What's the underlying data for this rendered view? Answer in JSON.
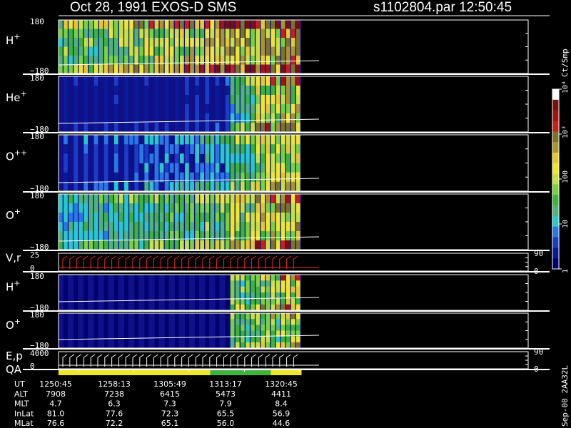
{
  "header": {
    "title_left": "Oct 28, 1991    EXOS-D SMS",
    "title_right": "s1102804.par  12:50:45"
  },
  "colorbar": {
    "label": "Ct/Smp",
    "ticks": [
      {
        "value": 1,
        "label": "1"
      },
      {
        "value": 10,
        "label": "10"
      },
      {
        "value": 100,
        "label": "100"
      },
      {
        "value": 1000,
        "label": "10³"
      },
      {
        "value": 10000,
        "label": "10⁴"
      }
    ],
    "colors": [
      "#000070",
      "#0a1a96",
      "#1a3cc8",
      "#2878e6",
      "#28c8c8",
      "#50b478",
      "#3cb43c",
      "#78d23c",
      "#c8e13c",
      "#f0e628",
      "#e6c828",
      "#aa9628",
      "#7d7328",
      "#c81e1e",
      "#a01414",
      "#781010",
      "#ffffff"
    ]
  },
  "footer": {
    "version": "Sep-00  2AA32L",
    "table_rows": [
      {
        "label": "UT",
        "values": [
          "1250:45",
          "1258:13",
          "1305:49",
          "1313:17",
          "1320:45"
        ]
      },
      {
        "label": "ALT",
        "values": [
          "7908",
          "7238",
          "6415",
          "5473",
          "4411"
        ]
      },
      {
        "label": "MLT",
        "values": [
          "4.7",
          "6.3",
          "7.3",
          "7.9",
          "8.4"
        ]
      },
      {
        "label": "InLat",
        "values": [
          "81.0",
          "77.6",
          "72.3",
          "65.5",
          "56.9"
        ]
      },
      {
        "label": "MLat",
        "values": [
          "76.6",
          "72.2",
          "65.1",
          "56.0",
          "44.6"
        ]
      }
    ]
  },
  "chart_data": [
    {
      "type": "heatmap",
      "label": "H",
      "sup": "+",
      "ylim": [
        -180,
        180
      ],
      "yticks": [
        "180",
        "−180"
      ],
      "intensity": [
        0.6,
        0.65,
        0.7,
        0.75,
        0.8,
        0.85,
        0.9,
        0.95,
        1.0,
        1.0
      ]
    },
    {
      "type": "heatmap",
      "label": "He",
      "sup": "+",
      "ylim": [
        -180,
        180
      ],
      "yticks": [
        "180",
        "−180"
      ],
      "intensity": [
        0.15,
        0.15,
        0.15,
        0.15,
        0.15,
        0.2,
        0.2,
        0.5,
        0.8,
        0.85
      ]
    },
    {
      "type": "heatmap",
      "label": "O",
      "sup": "++",
      "ylim": [
        -180,
        180
      ],
      "yticks": [
        "180",
        "−180"
      ],
      "intensity": [
        0.2,
        0.25,
        0.25,
        0.3,
        0.3,
        0.35,
        0.4,
        0.55,
        0.75,
        0.8
      ]
    },
    {
      "type": "heatmap",
      "label": "O",
      "sup": "+",
      "ylim": [
        -180,
        180
      ],
      "yticks": [
        "180",
        "−180"
      ],
      "intensity": [
        0.4,
        0.45,
        0.5,
        0.5,
        0.55,
        0.6,
        0.65,
        0.75,
        0.9,
        0.95
      ]
    },
    {
      "type": "line",
      "label": "V,r",
      "sup": "",
      "ylim": [
        0,
        25
      ],
      "yticks": [
        "25",
        "0"
      ],
      "right_ticks": [
        "90",
        "0"
      ]
    },
    {
      "type": "heatmap",
      "label": "H",
      "sup": "+",
      "ylim": [
        -180,
        180
      ],
      "yticks": [
        "180",
        "−180"
      ],
      "intensity": [
        0.05,
        0.05,
        0.05,
        0.05,
        0.05,
        0.05,
        0.05,
        0.6,
        0.7,
        0.8
      ]
    },
    {
      "type": "heatmap",
      "label": "O",
      "sup": "+",
      "ylim": [
        -180,
        180
      ],
      "yticks": [
        "180",
        "−180"
      ],
      "intensity": [
        0.05,
        0.05,
        0.05,
        0.05,
        0.05,
        0.05,
        0.05,
        0.55,
        0.65,
        0.75
      ]
    },
    {
      "type": "line",
      "label": "E,p",
      "sup": "",
      "ylim": [
        0,
        4000
      ],
      "yticks": [
        "4000",
        "0"
      ],
      "right_ticks": [
        "90",
        "0"
      ]
    },
    {
      "type": "bar",
      "label": "QA",
      "sup": "",
      "colors": [
        "#f0e628",
        "#f0e628",
        "#f0e628",
        "#f0e628",
        "#f0e628",
        "#3cb43c",
        "#3cb43c",
        "#f0e628"
      ]
    }
  ]
}
